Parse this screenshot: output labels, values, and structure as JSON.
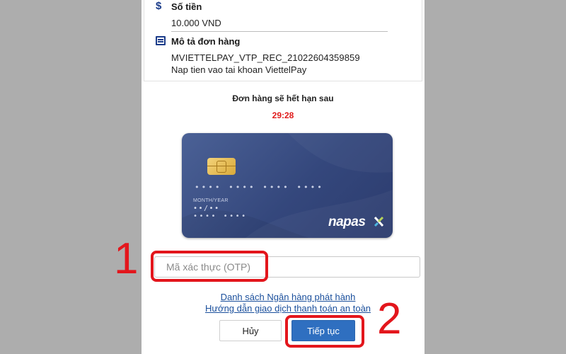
{
  "order_info": {
    "amount_label": "Số tiền",
    "amount_value": "10.000 VND",
    "description_label": "Mô tả đơn hàng",
    "order_code": "MVIETTELPAY_VTP_REC_21022604359859",
    "order_note": "Nap tien vao tai khoan ViettelPay"
  },
  "expiry": {
    "text": "Đơn hàng sẽ hết hạn sau",
    "countdown": "29:28"
  },
  "card": {
    "number_mask": "•••• •••• •••• ••••",
    "month_year_label": "MONTH/YEAR",
    "expiry_mask": "••/••",
    "holder_mask": "•••• ••••",
    "brand": "napas"
  },
  "otp": {
    "placeholder": "Mã xác thực (OTP)"
  },
  "links": {
    "issuing_banks": "Danh sách Ngân hàng phát hành",
    "safe_guide": "Hướng dẫn giao dịch thanh toán an toàn"
  },
  "buttons": {
    "cancel": "Hủy",
    "continue": "Tiếp tục"
  },
  "annotations": {
    "step1": "1",
    "step2": "2",
    "color": "#e3161c"
  },
  "colors": {
    "brand_blue": "#2f6fc0",
    "timer_red": "#e01b1b",
    "card_blue": "#34477c"
  }
}
